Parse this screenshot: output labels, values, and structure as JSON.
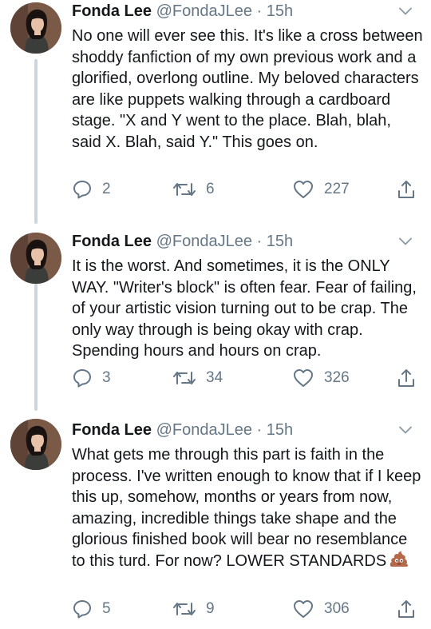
{
  "tweets": [
    {
      "name": "Fonda Lee",
      "handle": "@FondaJLee",
      "separator": "·",
      "time": "15h",
      "text": "No one will ever see this. It's like a cross between shoddy fanfiction of my own previous work and a glorified, overlong outline. My beloved characters are like puppets walking through a cardboard stage. \"X and Y went to the place. Blah, blah, said X. Blah, said Y.\" This goes on.",
      "replies": "2",
      "retweets": "6",
      "likes": "227"
    },
    {
      "name": "Fonda Lee",
      "handle": "@FondaJLee",
      "separator": "·",
      "time": "15h",
      "text": "It is the worst. And sometimes, it is the ONLY WAY. \"Writer's block\" is often fear. Fear of failing, of your artistic vision turning out to be crap. The only way through is being okay with crap. Spending hours and hours on crap.",
      "replies": "3",
      "retweets": "34",
      "likes": "326"
    },
    {
      "name": "Fonda Lee",
      "handle": "@FondaJLee",
      "separator": "·",
      "time": "15h",
      "text": "What gets me through this part is faith in the process. I've written enough to know that if I keep this up, somehow, months or years from now, amazing, incredible things take shape and the glorious finished book will bear no resemblance to this turd. For now? LOWER STANDARDS",
      "emoji": "pile-of-poo",
      "replies": "5",
      "retweets": "9",
      "likes": "306"
    }
  ],
  "icons": {
    "reply": "reply-icon",
    "retweet": "retweet-icon",
    "like": "heart-icon",
    "share": "share-icon",
    "more": "chevron-down-icon"
  },
  "colors": {
    "text": "#14171a",
    "secondary": "#657786",
    "thread_line": "#ccd6dd"
  }
}
